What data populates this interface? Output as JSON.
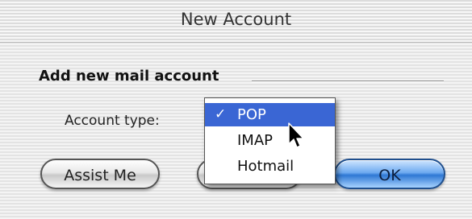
{
  "window": {
    "title": "New Account"
  },
  "section": {
    "heading": "Add new mail account"
  },
  "account_type": {
    "label": "Account type:",
    "selected": "POP",
    "options": [
      {
        "check": "✓",
        "label": "POP",
        "selected": true
      },
      {
        "check": "",
        "label": "IMAP",
        "selected": false
      },
      {
        "check": "",
        "label": "Hotmail",
        "selected": false
      }
    ]
  },
  "buttons": {
    "assist": "Assist Me",
    "ok": "OK"
  },
  "icons": {
    "cursor": "arrow-cursor-icon",
    "check": "checkmark-icon"
  },
  "colors": {
    "menu_highlight": "#3a66d4",
    "default_button": "#4f92e6"
  }
}
